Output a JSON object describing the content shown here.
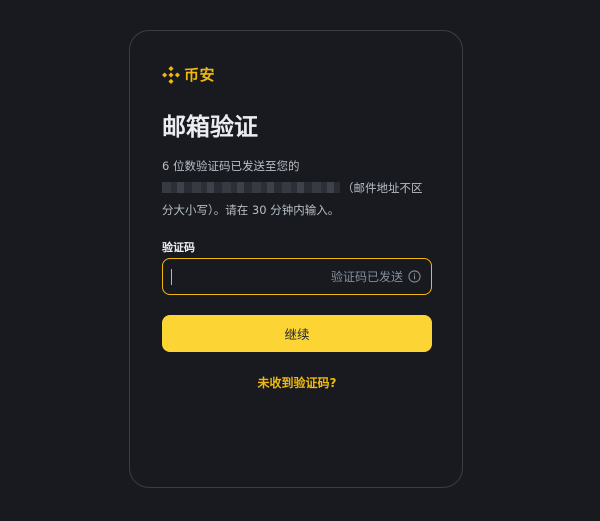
{
  "brand": {
    "name": "币安",
    "logo_icon": "binance-logo-icon",
    "accent_color": "#f0b90b"
  },
  "page": {
    "title": "邮箱验证",
    "description_line1": "6 位数验证码已发送至您的",
    "description_line2_suffix": "（邮件地址不区",
    "description_line3": "分大小写）。请在 30 分钟内输入。"
  },
  "code_field": {
    "label": "验证码",
    "value": "",
    "placeholder": "",
    "status_text": "验证码已发送",
    "status_icon": "info-icon"
  },
  "actions": {
    "continue_label": "继续",
    "continue_color": "#fcd535",
    "resend_link": "未收到验证码?"
  }
}
